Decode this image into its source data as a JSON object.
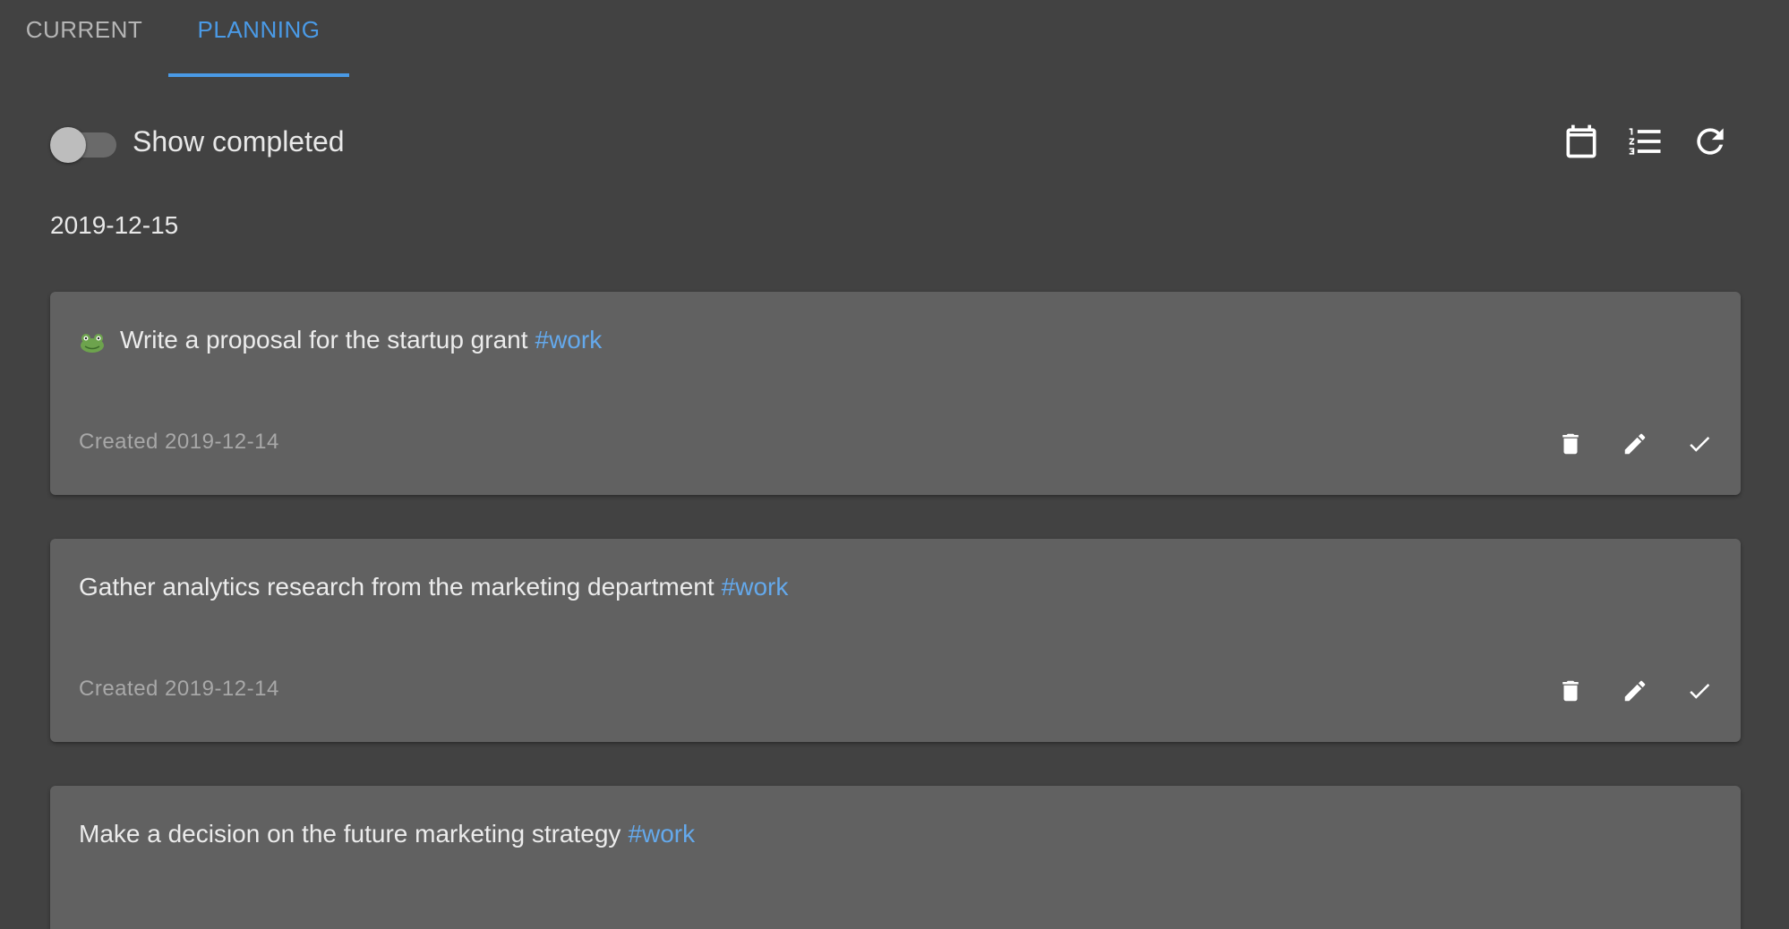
{
  "tabs": [
    {
      "label": "CURRENT",
      "active": false
    },
    {
      "label": "PLANNING",
      "active": true
    }
  ],
  "accent_color": "#4a9ae6",
  "toolbar": {
    "show_completed_label": "Show completed",
    "show_completed_on": false,
    "icons": [
      "calendar-icon",
      "ordered-list-icon",
      "refresh-icon"
    ]
  },
  "date_heading": "2019-12-15",
  "tasks": [
    {
      "icon": "frog-icon",
      "text": "Write a proposal for the startup grant",
      "tag": "#work",
      "created": "Created 2019-12-14"
    },
    {
      "text": "Gather analytics research from the marketing department",
      "tag": "#work",
      "created": "Created 2019-12-14"
    },
    {
      "text": "Make a decision on the future marketing strategy",
      "tag": "#work"
    }
  ],
  "task_actions": [
    "delete-icon",
    "edit-icon",
    "check-icon"
  ]
}
